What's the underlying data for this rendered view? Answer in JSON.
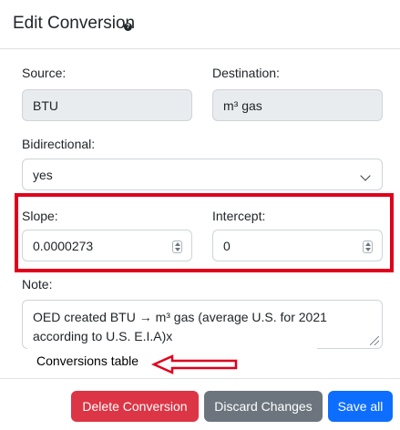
{
  "modal": {
    "title": "Edit Conversion",
    "help_icon_label": "?"
  },
  "form": {
    "source_label": "Source:",
    "source_value": "BTU",
    "destination_label": "Destination:",
    "destination_value": "m³ gas",
    "bidirectional_label": "Bidirectional:",
    "bidirectional_value": "yes",
    "slope_label": "Slope:",
    "slope_value": "0.0000273",
    "intercept_label": "Intercept:",
    "intercept_value": "0",
    "note_label": "Note:",
    "note_value": "OED created BTU → m³ gas (average U.S. for 2021 according to U.S. E.I.A)x"
  },
  "annotation": {
    "callout_text": "Conversions table",
    "highlight_color": "#e0001b"
  },
  "footer": {
    "delete_label": "Delete Conversion",
    "discard_label": "Discard Changes",
    "save_label": "Save all"
  },
  "colors": {
    "danger": "#dc3545",
    "secondary": "#6c757d",
    "primary": "#0d6efd"
  }
}
